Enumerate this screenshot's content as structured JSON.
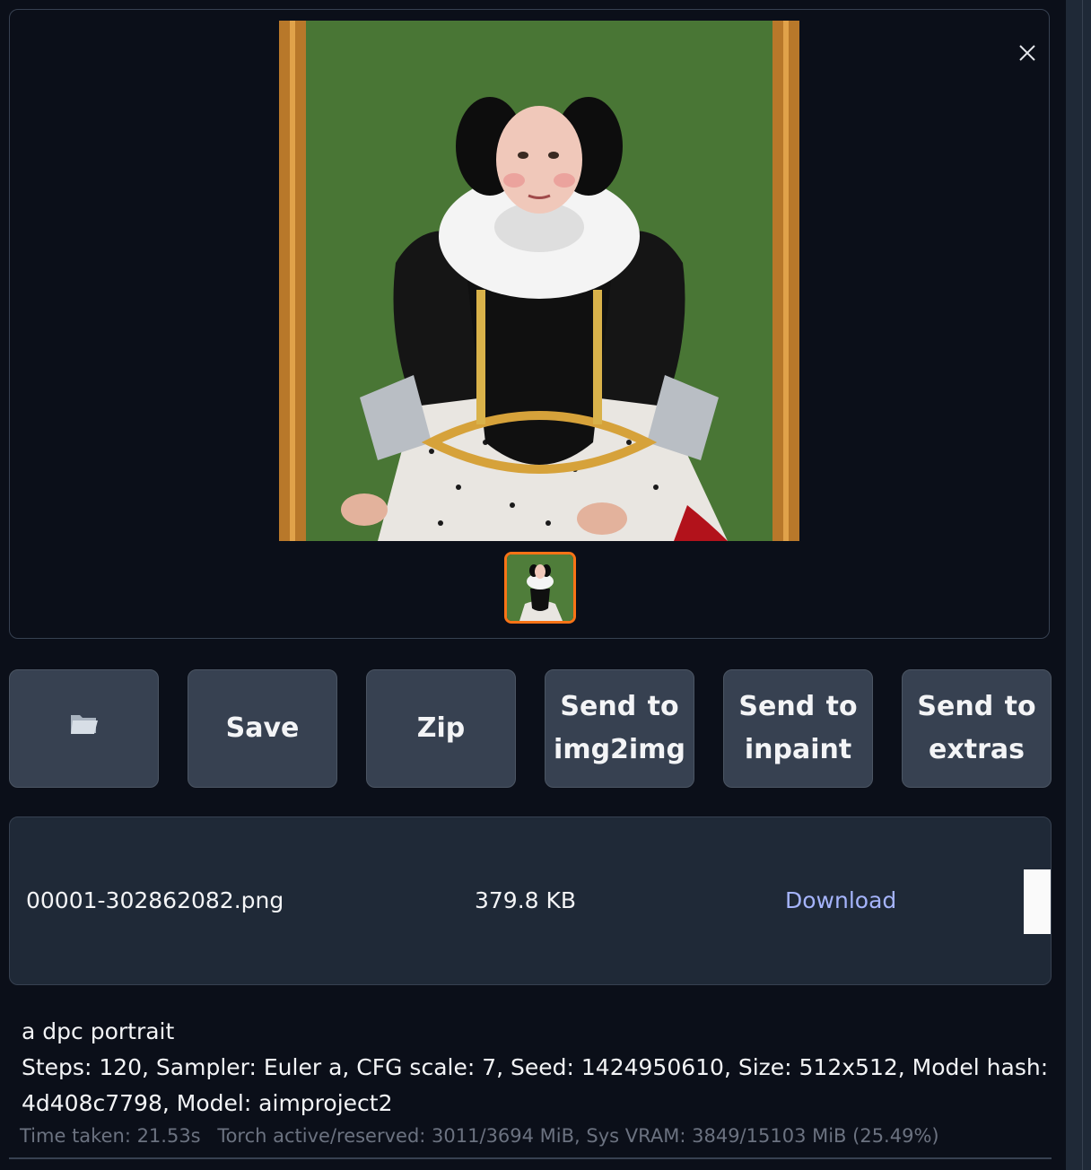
{
  "gallery": {
    "close_icon": "close-icon",
    "image_subject": "portrait-painting",
    "thumbnail_selected": true,
    "accent_color": "#f97316"
  },
  "actions": {
    "folder_icon": "folder-icon",
    "save_label": "Save",
    "zip_label": "Zip",
    "send_img2img_label": "Send to img2img",
    "send_inpaint_label": "Send to inpaint",
    "send_extras_label": "Send to extras"
  },
  "file": {
    "name": "00001-302862082.png",
    "size": "379.8 KB",
    "download_label": "Download",
    "link_color": "#a5b4fc"
  },
  "generation": {
    "prompt": "a dpc portrait",
    "params": "Steps: 120, Sampler: Euler a, CFG scale: 7, Seed: 1424950610, Size: 512x512, Model hash: 4d408c7798, Model: aimproject2"
  },
  "timing": {
    "time_taken": "Time taken: 21.53s",
    "memory": "Torch active/reserved: 3011/3694 MiB, Sys VRAM: 3849/15103 MiB (25.49%)"
  }
}
